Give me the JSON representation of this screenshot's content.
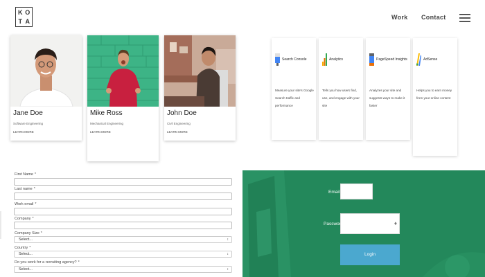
{
  "header": {
    "logo_letters": [
      "K",
      "O",
      "T",
      "A"
    ],
    "nav": {
      "work": "Work",
      "contact": "Contact"
    }
  },
  "profiles": [
    {
      "name": "Jane Doe",
      "role": "Software Engineering",
      "more": "LEARN MORE"
    },
    {
      "name": "Mike Ross",
      "role": "Mechanical Engineering",
      "more": "LEARN MORE"
    },
    {
      "name": "John Doe",
      "role": "Civil Engineering",
      "more": "LEARN MORE"
    }
  ],
  "tools": [
    {
      "icon": "search-console-icon",
      "title": "Search Console",
      "description": "Measure your site's Google Search traffic and performance"
    },
    {
      "icon": "analytics-icon",
      "title": "Analytics",
      "description": "Tells you how users find, use, and engage with your site"
    },
    {
      "icon": "pagespeed-icon",
      "title": "PageSpeed Insights",
      "description": "Analyzes your site and suggests ways to make it faster"
    },
    {
      "icon": "adsense-icon",
      "title": "AdSense",
      "description": "Helps you to earn money from your online content"
    }
  ],
  "form": {
    "first_name": "First Name",
    "last_name": "Last name",
    "work_email": "Work email",
    "company": "Company",
    "company_size": "Company Size",
    "country": "Country",
    "agency": "Do you work for a recruiting agency?",
    "required_mark": "*",
    "select_placeholder": "Select..."
  },
  "login": {
    "email_label": "Email",
    "password_label": "Password",
    "button": "Login"
  },
  "colors": {
    "login_bg": "#23885b",
    "login_button": "#4ba8cf"
  }
}
